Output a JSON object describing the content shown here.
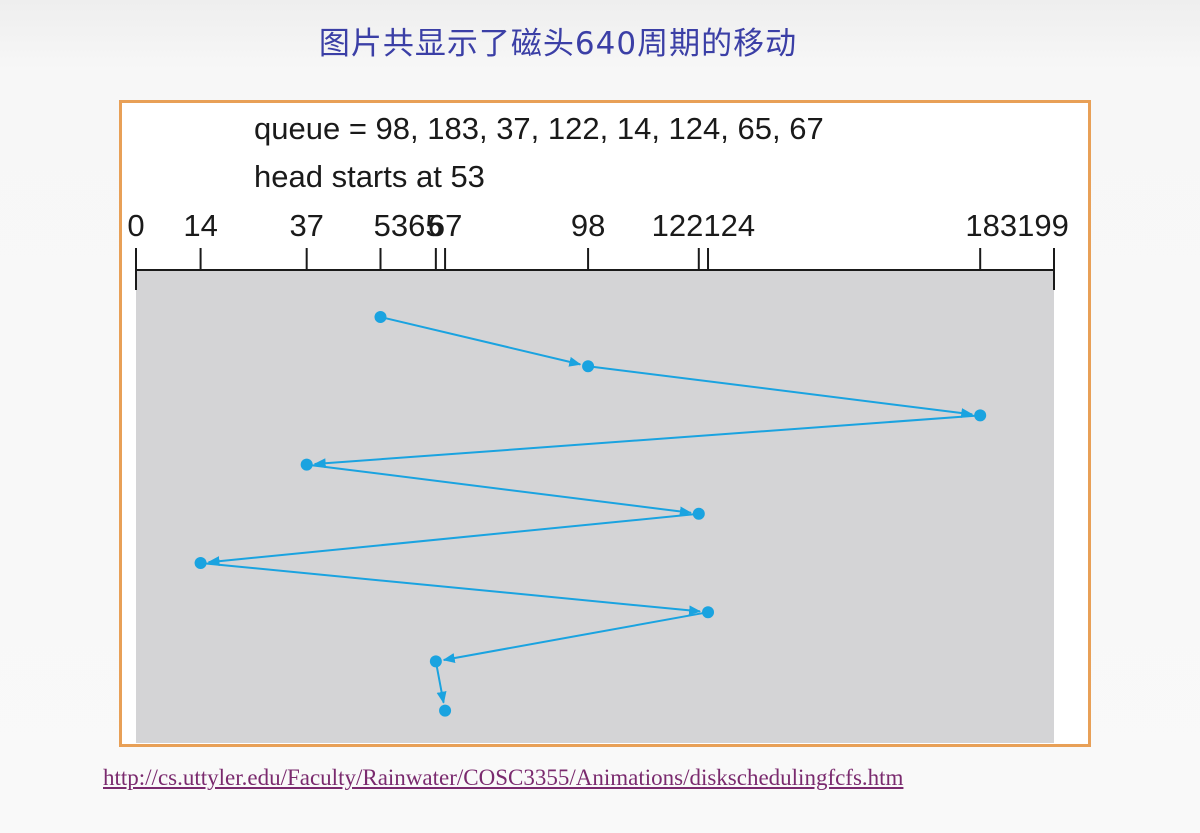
{
  "title": "图片共显示了磁头640周期的移动",
  "queue_text": "queue = 98, 183, 37, 122, 14, 124, 65, 67",
  "head_text": "head starts at 53",
  "source_url": "http://cs.uttyler.edu/Faculty/Rainwater/COSC3355/Animations/diskschedulingfcfs.htm",
  "colors": {
    "title": "#3b3fa6",
    "frame_border": "#e8a057",
    "plot_background": "#d4d4d6",
    "path": "#1aa3e0",
    "link": "#7a2a6e"
  },
  "axis": {
    "min": 0,
    "max": 199,
    "ticks": [
      0,
      14,
      37,
      53,
      65,
      67,
      98,
      122,
      124,
      183,
      199
    ],
    "tick_labels": [
      {
        "text": "0",
        "value": 0
      },
      {
        "text": "14",
        "value": 14
      },
      {
        "text": "37",
        "value": 37
      },
      {
        "text": "5365",
        "value": 59
      },
      {
        "text": "67",
        "value": 67
      },
      {
        "text": "98",
        "value": 98
      },
      {
        "text": "122124",
        "value": 123
      },
      {
        "text": "183199",
        "value": 191
      }
    ]
  },
  "head_path": [
    53,
    98,
    183,
    37,
    122,
    14,
    124,
    65,
    67
  ]
}
